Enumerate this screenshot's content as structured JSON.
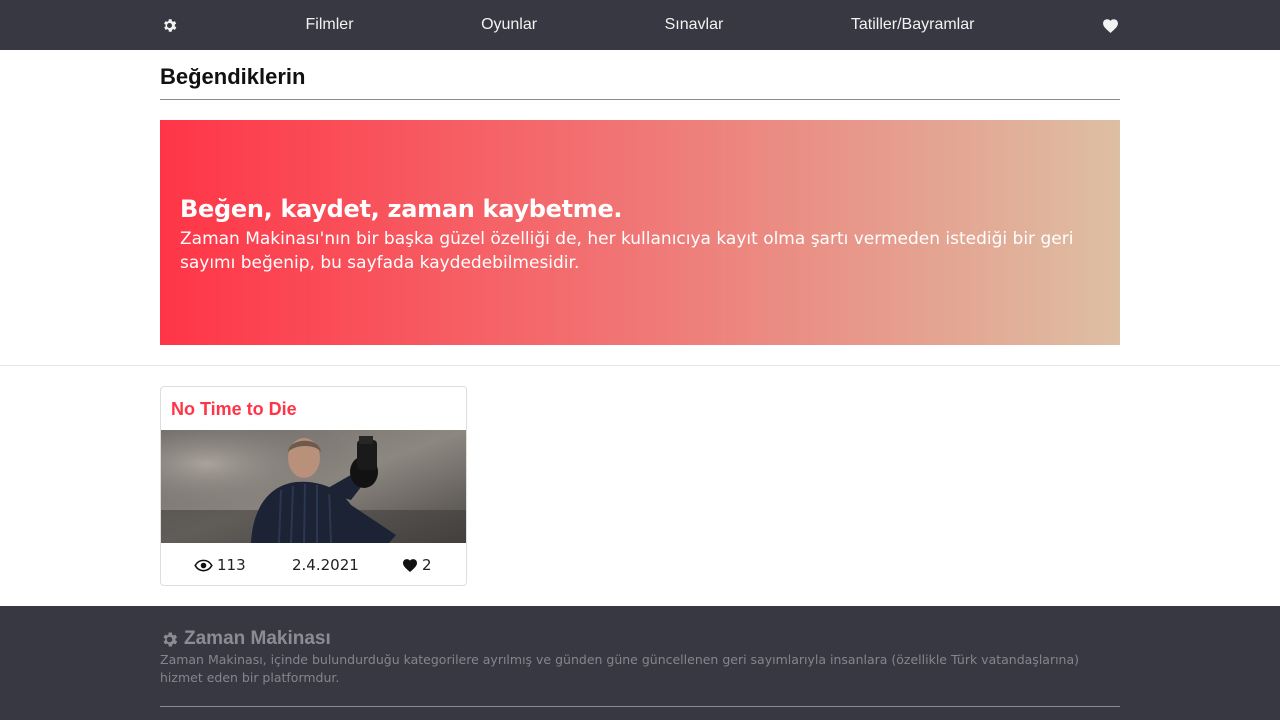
{
  "nav": {
    "settings_icon": "gear-icon",
    "items": [
      {
        "label": "Filmler"
      },
      {
        "label": "Oyunlar"
      },
      {
        "label": "Sınavlar"
      },
      {
        "label": "Tatiller/Bayramlar"
      }
    ],
    "favorites_icon": "heart-icon"
  },
  "page": {
    "title": "Beğendiklerin"
  },
  "banner": {
    "heading": "Beğen, kaydet, zaman kaybetme.",
    "text": "Zaman Makinası'nın bir başka güzel özelliği de, her kullanıcıya kayıt olma şartı vermeden istediği bir geri sayımı beğenip, bu sayfada kaydedebilmesidir.",
    "gradient_start": "#ff3547",
    "gradient_end": "#ddbfa3"
  },
  "cards": [
    {
      "title": "No Time to Die",
      "image_icon": "movie-still-image",
      "views": "113",
      "date": "2.4.2021",
      "likes": "2"
    }
  ],
  "footer": {
    "brand": "Zaman Makinası",
    "description": "Zaman Makinası, içinde bulundurduğu kategorilere ayrılmış ve günden güne güncellenen geri sayımlarıyla insanlara (özellikle Türk vatandaşlarına) hizmet eden bir platformdur."
  },
  "colors": {
    "nav_bg": "#383842",
    "accent": "#ff3547",
    "footer_bg": "#383842"
  }
}
